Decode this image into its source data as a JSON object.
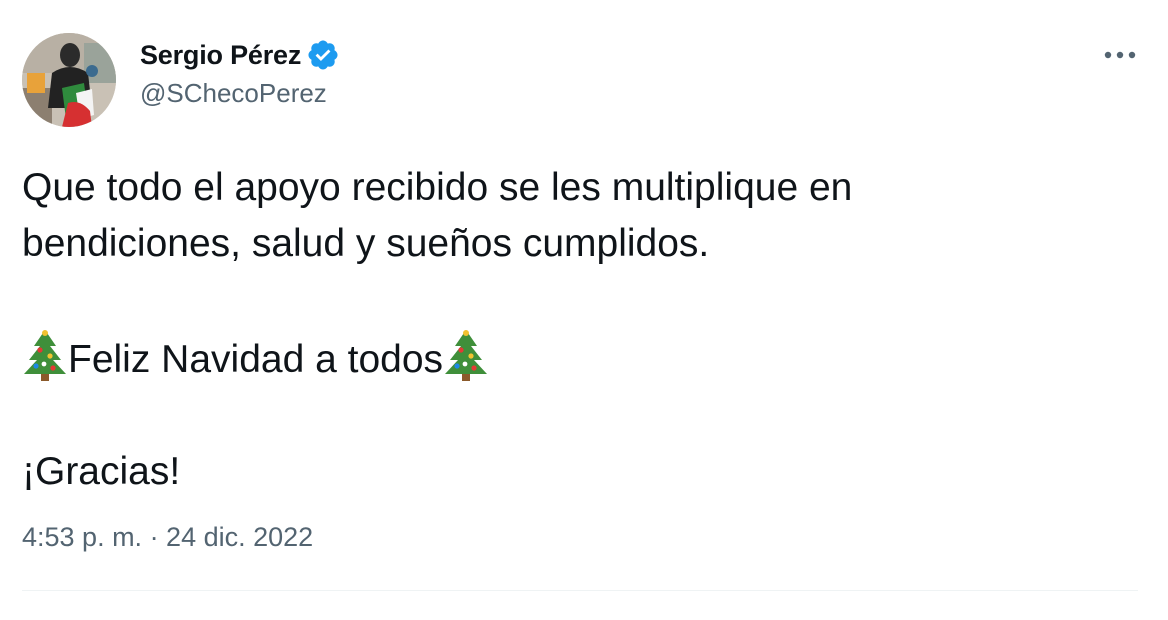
{
  "author": {
    "display_name": "Sergio Pérez",
    "handle": "@SChecoPerez",
    "verified": true
  },
  "tweet": {
    "line1": "Que todo el apoyo recibido se les multiplique en",
    "line2": "bendiciones, salud y sueños cumplidos.",
    "greeting": "Feliz Navidad a todos",
    "thanks": "¡Gracias!",
    "timestamp": "4:53 p. m. · 24 dic. 2022"
  },
  "icons": {
    "verified": "verified-badge-icon",
    "more": "more-options-icon",
    "emoji": "christmas-tree-emoji"
  },
  "colors": {
    "text": "#0f1419",
    "secondary": "#536471",
    "verified_blue": "#1d9bf0",
    "divider": "#eff3f4"
  }
}
